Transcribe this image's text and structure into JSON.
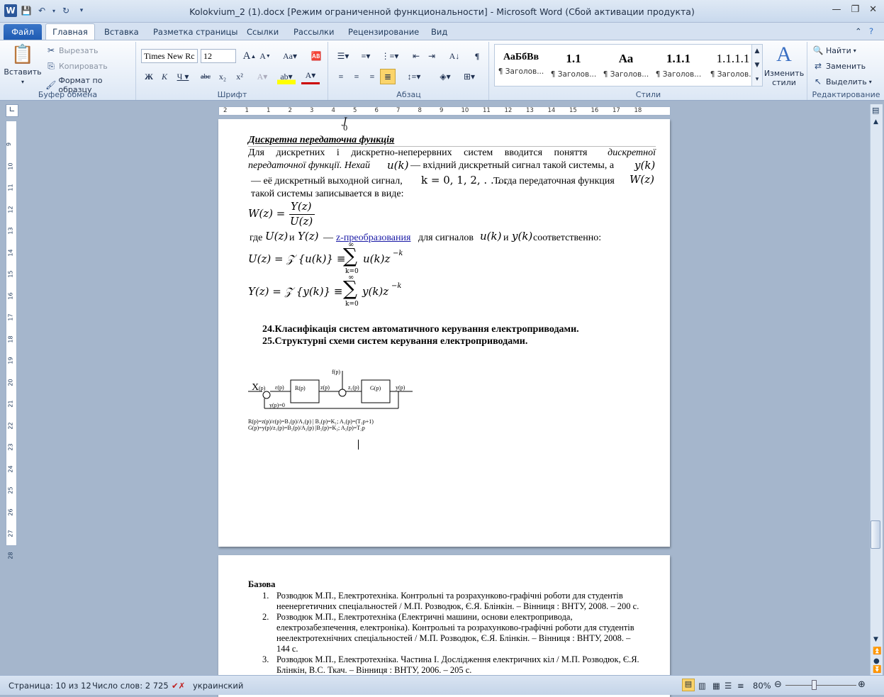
{
  "window": {
    "title": "Kolokvium_2 (1).docx [Режим ограниченной функциональности]  -  Microsoft Word (Сбой активации продукта)",
    "app_icon": "word-icon"
  },
  "tabs": [
    "Файл",
    "Главная",
    "Вставка",
    "Разметка страницы",
    "Ссылки",
    "Рассылки",
    "Рецензирование",
    "Вид"
  ],
  "ribbon": {
    "clipboard": {
      "paste": "Вставить",
      "cut": "Вырезать",
      "copy": "Копировать",
      "format_painter": "Формат по образцу",
      "label": "Буфер обмена"
    },
    "font": {
      "family": "Times New Rc",
      "size": "12",
      "label": "Шрифт"
    },
    "paragraph": {
      "label": "Абзац"
    },
    "styles": {
      "label": "Стили",
      "items": [
        {
          "preview": "АаБбВв",
          "name": "¶ Заголов..."
        },
        {
          "preview": "1.1",
          "name": "¶ Заголов..."
        },
        {
          "preview": "Аа",
          "name": "¶ Заголов..."
        },
        {
          "preview": "1.1.1",
          "name": "¶ Заголов..."
        },
        {
          "preview": "1.1.1.1",
          "name": "¶ Заголов..."
        },
        {
          "preview": "1.1.1.1",
          "name": "¶ Заголов..."
        }
      ],
      "change_styles": "Изменить стили"
    },
    "editing": {
      "find": "Найти",
      "replace": "Заменить",
      "select": "Выделить",
      "label": "Редактирование"
    }
  },
  "ruler": {
    "ticks": [
      "2",
      "1",
      "1",
      "2",
      "3",
      "4",
      "5",
      "6",
      "7",
      "8",
      "9",
      "10",
      "11",
      "12",
      "13",
      "14",
      "15",
      "16",
      "17",
      "18"
    ]
  },
  "vruler": {
    "ticks": [
      "9",
      "10",
      "11",
      "12",
      "13",
      "14",
      "15",
      "16",
      "17",
      "18",
      "19",
      "20",
      "21",
      "22",
      "23",
      "24",
      "25",
      "26",
      "27",
      "28"
    ]
  },
  "document": {
    "heading": "Дискретна передаточна функція",
    "para1": {
      "l1": "Для дискретних і дискретно-неперервних систем вводится поняття",
      "l1_em": "дискретної",
      "l2_em": "передаточної функції. Нехай",
      "l2_mid": "— вхідний дискретный сигнал такой системы, а",
      "l3_a": "— её дискретный выходной сигнал,",
      "l3_k": "k = 0, 1, 2, . . . .",
      "l3_b": "Тогда передаточная функция",
      "l4": "такой системы записывается в виде:"
    },
    "math": {
      "u_k": "u(k)",
      "y_k": "y(k)",
      "W_z": "W(z)",
      "W_eq": "W(z) =",
      "Y_z": "Y(z)",
      "U_z": "U(z)",
      "U_def": "U(z) = 𝒵 {u(k)} ≡",
      "U_sum": "u(k)z",
      "Y_def": "Y(z) = 𝒵 {y(k)} ≡",
      "Y_sum": "y(k)z",
      "sup": "−k",
      "inf": "∞",
      "k0": "k=0",
      "sigma": "∑",
      "integral_top": "J",
      "integral_bot": "0"
    },
    "para2": {
      "where": "где",
      "and": "и",
      "dash": "—",
      "link": "z-преобразования",
      "for": "для сигналов",
      "and2": "и",
      "resp": "соответственно:"
    },
    "items": [
      "24.Класифікація систем автоматичного керування електроприводами.",
      "25.Структурні схеми систем керування електроприводами."
    ],
    "diagram": {
      "labels": [
        "X",
        "(p)",
        "ε(p)",
        "R(p)",
        "z(p)",
        "f(p)",
        "z₁(p)",
        "G(p)",
        "y(p)",
        "y(p)=0"
      ],
      "eq1": "R(p)=z(p)/ε(p)=B₁(p)/A₁(p)   |  B₁(p)=K₁; A₁(p)=(T₁p+1)",
      "eq2": "G(p)=y(p)/z₁(p)=B₂(p)/A₂(p)   |B₂(p)=K₂; A₂(p)=T₂p"
    },
    "page2": {
      "title": "Базова",
      "refs": [
        {
          "num": "1.",
          "lines": [
            "Розводюк М.П., Електротехніка. Контрольні та розрахунково-графічні роботи для студентів",
            "неенергетичних спеціальностей / М.П. Розводюк, Є.Я. Блінкін. – Вінниця : ВНТУ, 2008. – 200 с."
          ]
        },
        {
          "num": "2.",
          "lines": [
            "Розводюк М.П., Електротехніка (Електричні машини, основи електропривода,",
            "електрозабезпечення, електроніка). Контрольні та розрахунково-графічні роботи для студентів",
            "неелектротехнічних спеціальностей / М.П. Розводюк, Є.Я. Блінкін. – Вінниця : ВНТУ, 2008. –",
            "144 с."
          ]
        },
        {
          "num": "3.",
          "lines": [
            "Розводюк М.П., Електротехніка. Частина I. Дослідження електричних кіл / М.П. Розводюк, Є.Я.",
            "Блінкін, В.С. Ткач. – Вінниця : ВНТУ, 2006. – 205 с."
          ]
        }
      ]
    }
  },
  "status": {
    "page": "Страница: 10 из 12",
    "words": "Число слов: 2 725",
    "lang": "украинский",
    "zoom": "80%"
  },
  "colors": {
    "accent": "#2b579a",
    "link": "#1a1aa6",
    "squiggle": "#d22222"
  }
}
